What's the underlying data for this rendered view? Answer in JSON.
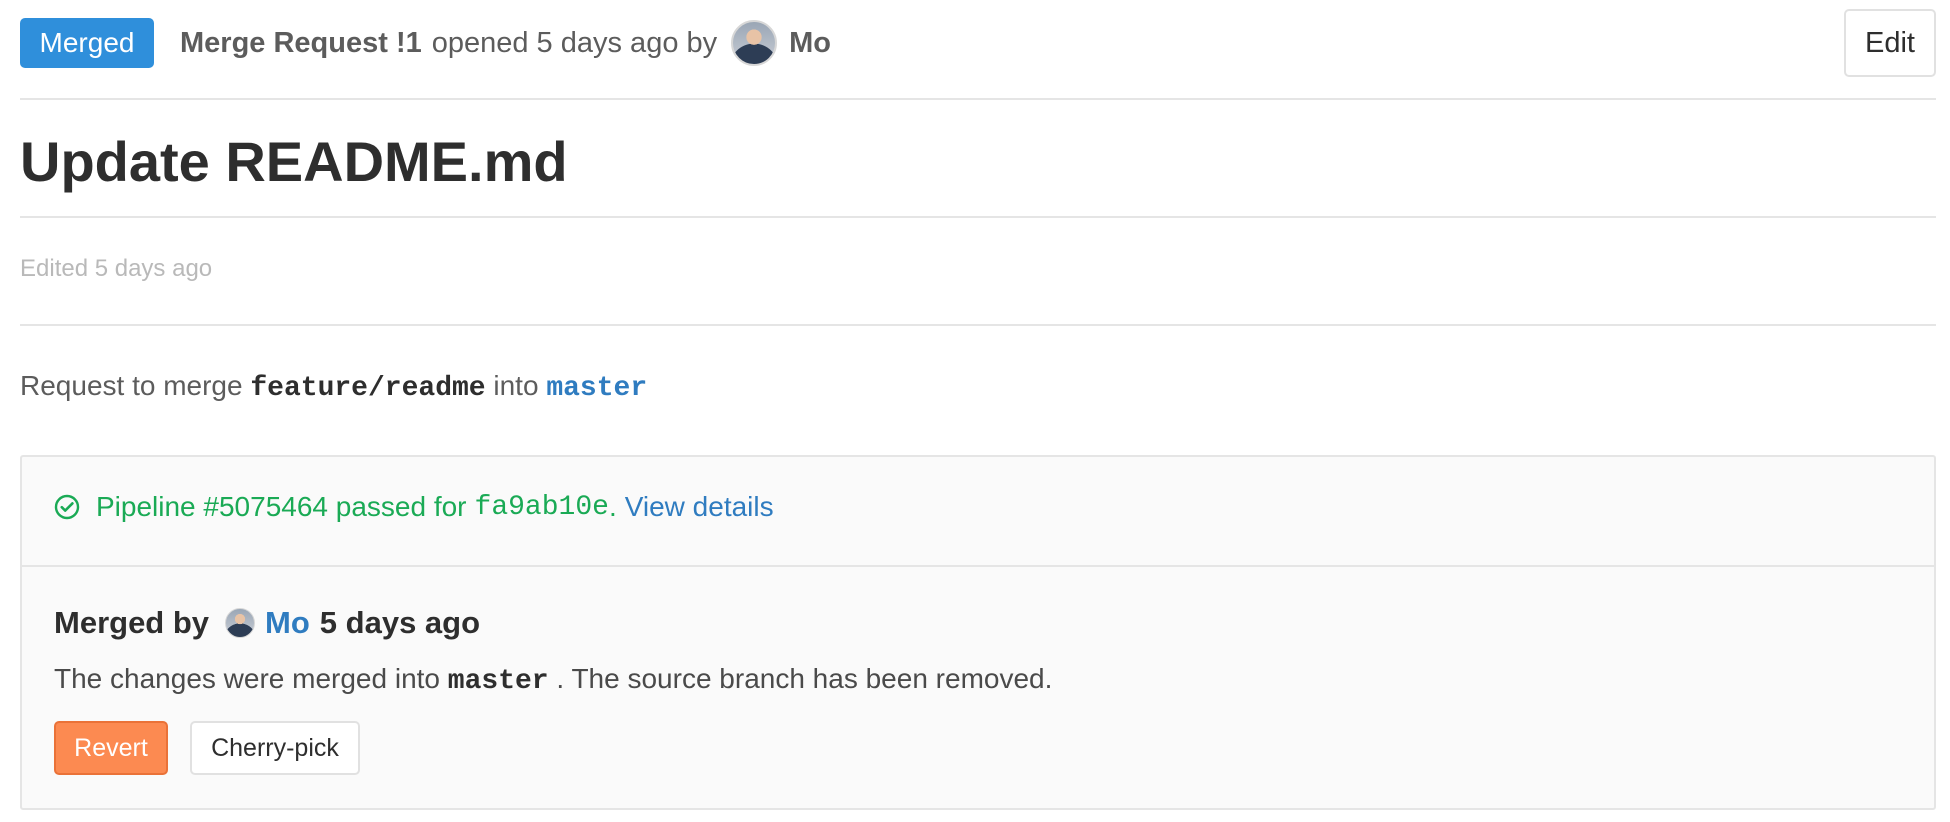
{
  "header": {
    "status_badge": "Merged",
    "request_label": "Merge Request !1",
    "opened_text": "opened 5 days ago by",
    "author": "Mo",
    "edit_label": "Edit"
  },
  "title": "Update README.md",
  "edited_text": "Edited 5 days ago",
  "request": {
    "prefix": "Request to merge",
    "source_branch": "feature/readme",
    "middle": "into",
    "target_branch": "master"
  },
  "widget": {
    "pipeline_prefix": "Pipeline #5075464 passed for",
    "commit_sha": "fa9ab10e",
    "pipeline_suffix": ".",
    "view_details_label": "View details",
    "merged_by_label": "Merged by",
    "merged_by_user": "Mo",
    "merged_time": "5 days ago",
    "merged_prefix": "The changes were merged into",
    "merged_branch": "master",
    "merged_suffix": ". The source branch has been removed.",
    "revert_label": "Revert",
    "cherry_pick_label": "Cherry-pick"
  },
  "colors": {
    "merged_badge": "#2f8fdb",
    "success": "#1aaa55",
    "link": "#2f7cc0",
    "revert": "#fc8a51"
  },
  "icons": {
    "avatar": "user-avatar",
    "pipeline_status": "check-circle-icon"
  }
}
